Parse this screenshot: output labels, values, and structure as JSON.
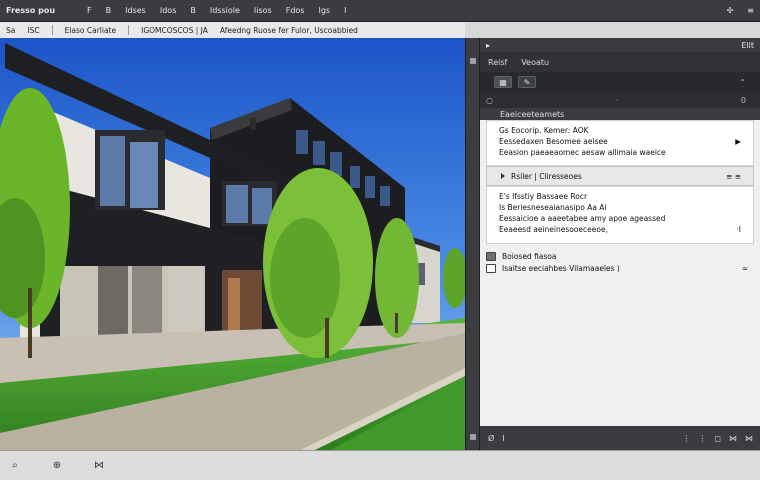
{
  "menu": {
    "app": "Fresso pou",
    "items": [
      "F",
      "B",
      "Idses",
      "Idos",
      "B",
      "Idssiole",
      "Iisos",
      "Fdos",
      "Igs",
      "I"
    ],
    "right": [
      "✣",
      "≡"
    ]
  },
  "pathbar": {
    "items": [
      "Sa",
      "ISC",
      "Elaso Carliate",
      "IGOMCOSCOS | JA",
      "Afeedng Ruose fer Fulor, Uscoabbied"
    ]
  },
  "panel": {
    "header_left": "▸",
    "header_right": "Ellt",
    "tabs": [
      "Reisf",
      "Veoatu"
    ],
    "tool_right": "⌃",
    "status_left": "○",
    "status_mid": "·",
    "status_right": "0",
    "properties_title": "Eaeiceeteamets",
    "card1": [
      "Gs Eocorip. Kemer: AOK",
      "Eessedaxen Besomee aeisee",
      "Eeasion paeaeaomec aesaw allimaia waeice"
    ],
    "card1_arrow": "▶",
    "section": {
      "label": "Rsiler | Cliresseoes",
      "right": "≡ ≡"
    },
    "card2": [
      "E's Ifsstiy Bassaee Rocr",
      "Is Beriesneseaianasipo Aa Ai",
      "Eessaicioe a aaeetabee amy apoe ageassed",
      "Eeaeesd aeineinesooeceeoe,"
    ],
    "card2_end": "·I",
    "layers": [
      {
        "label": "Boiosed fiasoa",
        "checked": true
      },
      {
        "label": "Isaitse eeciahbes  Vilamaaeles )",
        "checked": false
      }
    ],
    "layers_right": "≈",
    "foot_left": "Ø",
    "foot_mid": "I",
    "foot_right": [
      "⋮",
      "⋮",
      "◻",
      "⋈",
      "⋈"
    ]
  },
  "statusbar": {
    "items": [
      "⌕",
      "⊕",
      "⋈"
    ]
  },
  "colors": {
    "sky_top": "#1b55c8",
    "building_dark": "#1e1f22",
    "wall_white": "#e9e6df",
    "grass": "#3f9a2a",
    "path": "#b9b1a2"
  }
}
